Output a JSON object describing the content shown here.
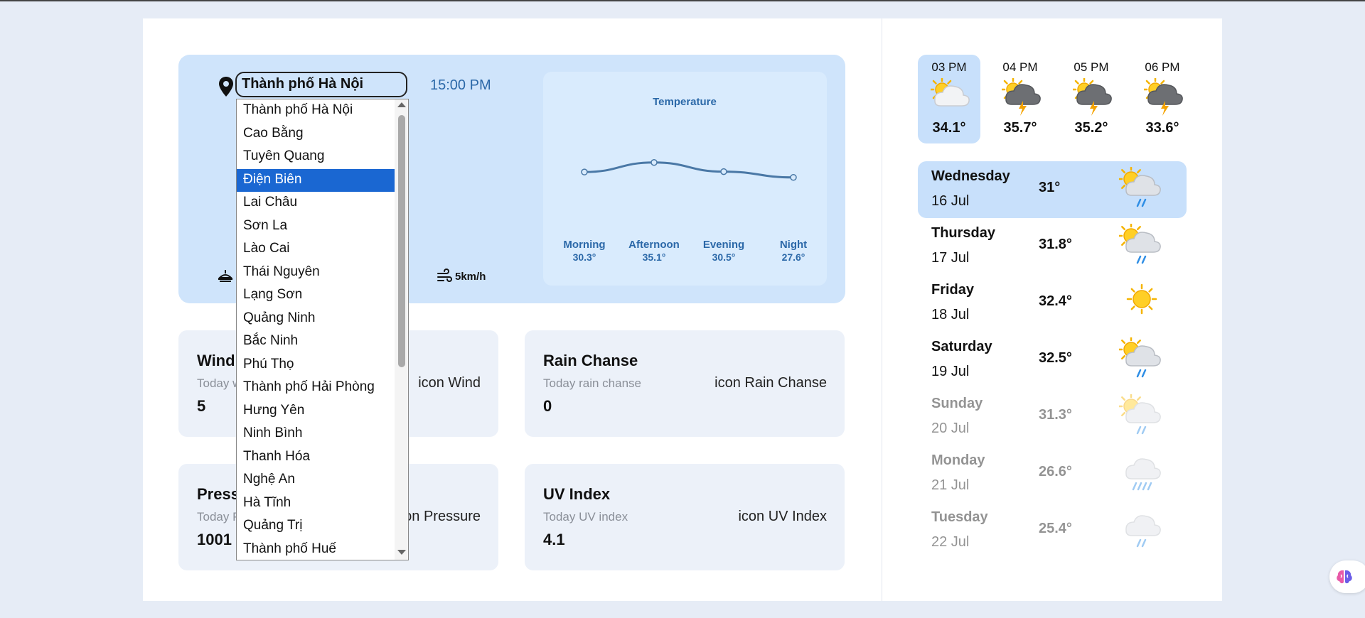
{
  "location": {
    "selected_city": "Thành phố Hà Nội",
    "time": "15:00 PM",
    "wind_speed": "5km/h"
  },
  "city_options": [
    "Thành phố Hà Nội",
    "Cao Bằng",
    "Tuyên Quang",
    "Điện Biên",
    "Lai Châu",
    "Sơn La",
    "Lào Cai",
    "Thái Nguyên",
    "Lạng Sơn",
    "Quảng Ninh",
    "Bắc Ninh",
    "Phú Thọ",
    "Thành phố Hải Phòng",
    "Hưng Yên",
    "Ninh Bình",
    "Thanh Hóa",
    "Nghệ An",
    "Hà Tĩnh",
    "Quảng Trị",
    "Thành phố Huế"
  ],
  "highlighted_option": "Điện Biên",
  "chart_data": {
    "type": "line",
    "title": "Temperature",
    "categories": [
      "Morning",
      "Afternoon",
      "Evening",
      "Night"
    ],
    "values": [
      30.3,
      35.1,
      30.5,
      27.6
    ],
    "value_labels": [
      "30.3°",
      "35.1°",
      "30.5°",
      "27.6°"
    ],
    "color": "#4a78a6"
  },
  "cards": {
    "wind": {
      "title": "Wind",
      "sub": "Today wind",
      "value": "5",
      "icon": "icon Wind"
    },
    "rain": {
      "title": "Rain Chanse",
      "sub": "Today rain chanse",
      "value": "0",
      "icon": "icon Rain Chanse"
    },
    "pressure": {
      "title": "Pressure",
      "sub": "Today Pressure",
      "value": "1001",
      "icon": "icon Pressure"
    },
    "uv": {
      "title": "UV Index",
      "sub": "Today UV index",
      "value": "4.1",
      "icon": "icon UV Index"
    }
  },
  "hourly": [
    {
      "time": "03 PM",
      "temp": "34.1°",
      "icon": "partly-cloudy-icon"
    },
    {
      "time": "04 PM",
      "temp": "35.7°",
      "icon": "thunderstorm-icon"
    },
    {
      "time": "05 PM",
      "temp": "35.2°",
      "icon": "thunderstorm-icon"
    },
    {
      "time": "06 PM",
      "temp": "33.6°",
      "icon": "thunderstorm-icon"
    }
  ],
  "daily": [
    {
      "day": "Wednesday",
      "date": "16 Jul",
      "temp": "31°",
      "icon": "sun-rain-icon"
    },
    {
      "day": "Thursday",
      "date": "17 Jul",
      "temp": "31.8°",
      "icon": "sun-rain-icon"
    },
    {
      "day": "Friday",
      "date": "18 Jul",
      "temp": "32.4°",
      "icon": "sun-icon"
    },
    {
      "day": "Saturday",
      "date": "19 Jul",
      "temp": "32.5°",
      "icon": "sun-rain-icon"
    },
    {
      "day": "Sunday",
      "date": "20 Jul",
      "temp": "31.3°",
      "icon": "sun-rain-icon"
    },
    {
      "day": "Monday",
      "date": "21 Jul",
      "temp": "26.6°",
      "icon": "heavy-rain-icon"
    },
    {
      "day": "Tuesday",
      "date": "22 Jul",
      "temp": "25.4°",
      "icon": "rain-icon"
    }
  ],
  "colors": {
    "accent": "#1a67d2",
    "hero_bg": "#cfe4fb",
    "card_bg": "#ecf1f9",
    "time_text": "#2b68a8"
  }
}
